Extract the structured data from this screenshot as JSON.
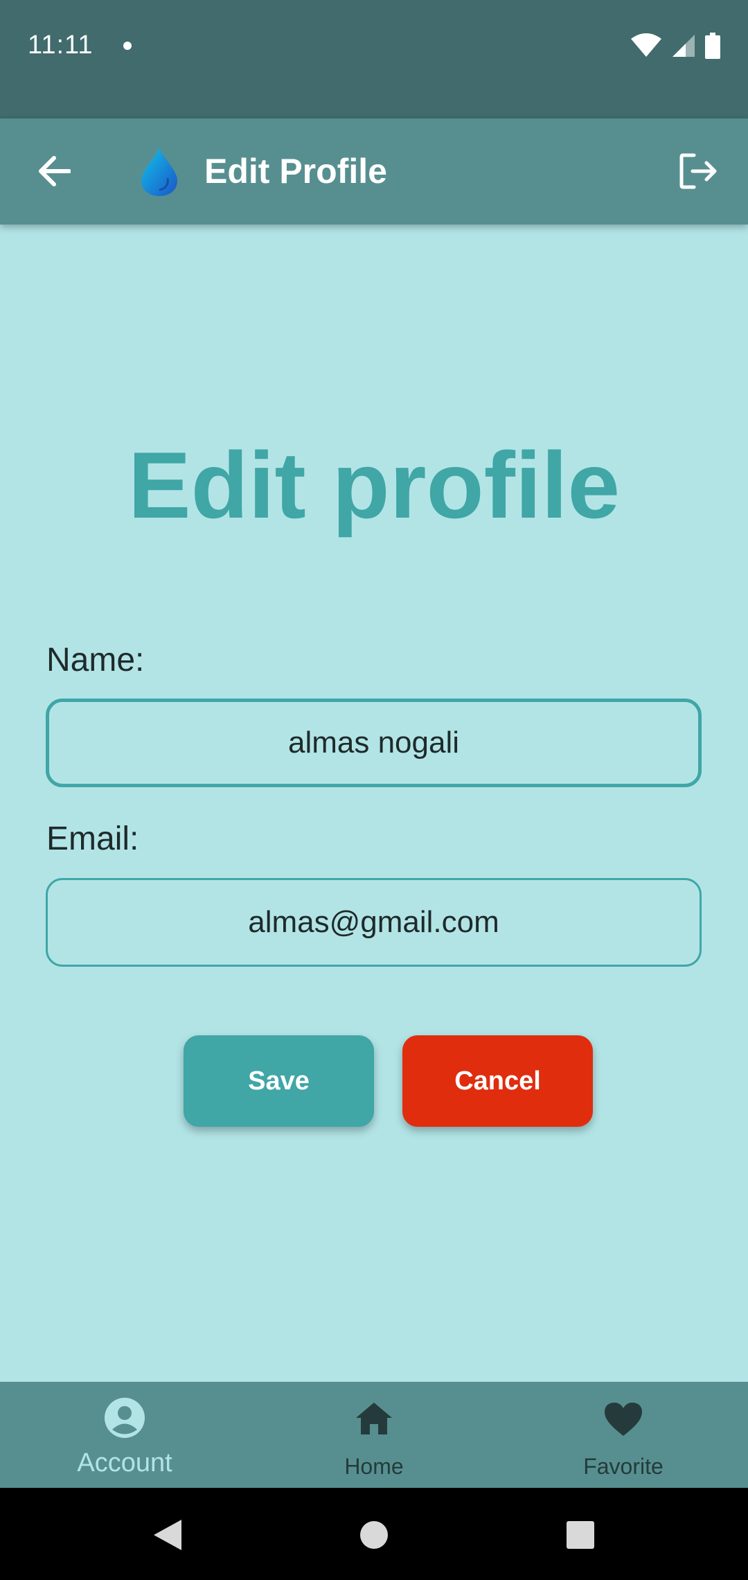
{
  "status_bar": {
    "time": "11:11",
    "icons": [
      "notification-dot-icon",
      "wifi-icon",
      "cellular-signal-icon",
      "battery-icon"
    ]
  },
  "app_bar": {
    "title": "Edit Profile",
    "back_icon": "arrow-back-icon",
    "logo_icon": "water-drop-icon",
    "logout_icon": "logout-icon"
  },
  "form": {
    "heading": "Edit profile",
    "name_label": "Name:",
    "name_value": "almas nogali",
    "email_label": "Email:",
    "email_value": "almas@gmail.com",
    "save_label": "Save",
    "cancel_label": "Cancel"
  },
  "bottom_nav": {
    "items": [
      {
        "label": "Account",
        "icon": "account-circle-icon",
        "active": true
      },
      {
        "label": "Home",
        "icon": "home-icon",
        "active": false
      },
      {
        "label": "Favorite",
        "icon": "heart-icon",
        "active": false
      }
    ]
  },
  "colors": {
    "background": "#b2e4e6",
    "status_bar": "#416b6c",
    "app_bar": "#578f90",
    "accent": "#40a6a6",
    "cancel": "#e02d0e"
  }
}
